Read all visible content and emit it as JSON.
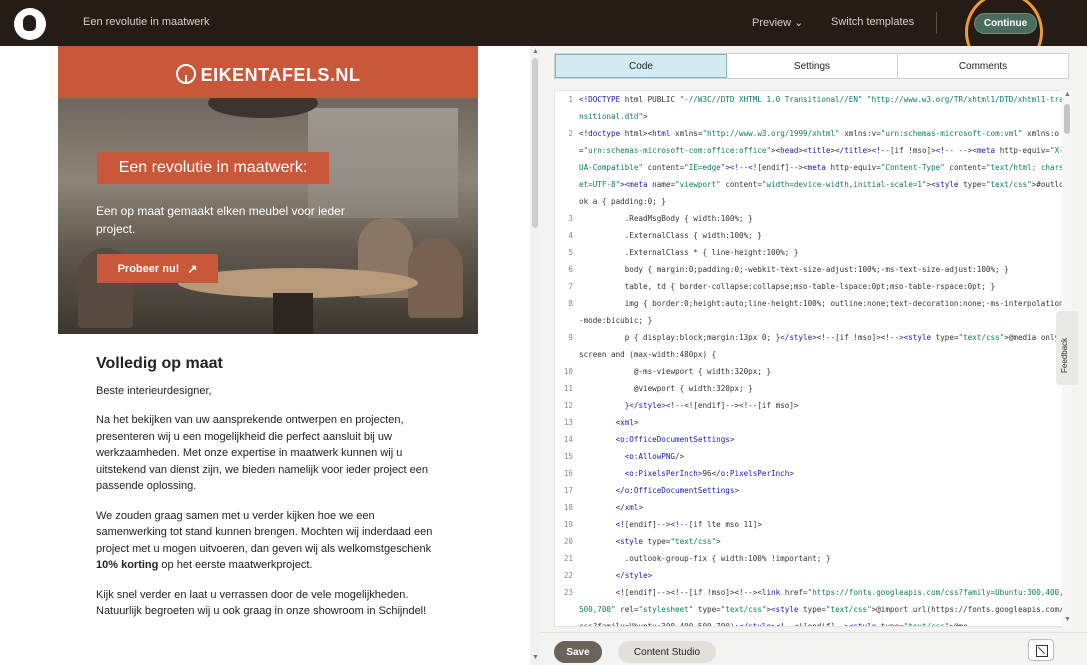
{
  "topbar": {
    "title": "Een revolutie in maatwerk",
    "preview_label": "Preview ⌄",
    "switch_label": "Switch templates",
    "continue_label": "Continue"
  },
  "email": {
    "brand": "EIKENTAFELS.NL",
    "headline": "Een revolutie in maatwerk:",
    "subtext": "Een op maat gemaakt elken meubel voor ieder project.",
    "cta": "Probeer nu!",
    "cta_arrow": "↗",
    "heading": "Volledig op maat",
    "greeting": "Beste interieurdesigner,",
    "p1": "Na het bekijken van uw aansprekende ontwerpen en projecten, presenteren wij u een mogelijkheid die perfect aansluit bij uw werkzaamheden. Met onze expertise in maatwerk kunnen wij u uitstekend van dienst zijn, we bieden namelijk voor ieder project een passende oplossing.",
    "p2a": "We zouden graag samen met u verder kijken hoe we een samenwerking tot stand kunnen brengen. Mochten wij inderdaad een project met u mogen uitvoeren, dan geven wij als welkomstgeschenk ",
    "p2b": "10% korting",
    "p2c": " op het eerste maatwerkproject.",
    "p3": "Kijk snel verder en laat u verrassen door de vele mogelijkheden. Natuurlijk begroeten wij u ook graag in onze showroom in Schijndel!"
  },
  "editor": {
    "tabs": [
      "Code",
      "Settings",
      "Comments"
    ],
    "active_tab": "Code",
    "feedback_label": "Feedback",
    "save_label": "Save",
    "studio_label": "Content Studio",
    "lines": [
      {
        "n": "1",
        "t": "<!DOCTYPE html PUBLIC \"-//W3C//DTD XHTML 1.0 Transitional//EN\" \"http://www.w3.org/TR/xhtml1/DTD/xhtml1-transitional.dtd\">"
      },
      {
        "n": "2",
        "t": "<!doctype html><html xmlns=\"http://www.w3.org/1999/xhtml\" xmlns:v=\"urn:schemas-microsoft-com:vml\" xmlns:o=\"urn:schemas-microsoft-com:office:office\"><head><title></title><!--[if !mso]><!-- --><meta http-equiv=\"X-UA-Compatible\" content=\"IE=edge\"><!--<![endif]--><meta http-equiv=\"Content-Type\" content=\"text/html; charset=UTF-8\"><meta name=\"viewport\" content=\"width=device-width,initial-scale=1\"><style type=\"text/css\">#outlook a { padding:0; }"
      },
      {
        "n": "3",
        "t": "          .ReadMsgBody { width:100%; }"
      },
      {
        "n": "4",
        "t": "          .ExternalClass { width:100%; }"
      },
      {
        "n": "5",
        "t": "          .ExternalClass * { line-height:100%; }"
      },
      {
        "n": "6",
        "t": "          body { margin:0;padding:0;-webkit-text-size-adjust:100%;-ms-text-size-adjust:100%; }"
      },
      {
        "n": "7",
        "t": "          table, td { border-collapse:collapse;mso-table-lspace:0pt;mso-table-rspace:0pt; }"
      },
      {
        "n": "8",
        "t": "          img { border:0;height:auto;line-height:100%; outline:none;text-decoration:none;-ms-interpolation-mode:bicubic; }"
      },
      {
        "n": "9",
        "t": "          p { display:block;margin:13px 0; }</style><!--[if !mso]><!--><style type=\"text/css\">@media only screen and (max-width:480px) {"
      },
      {
        "n": "10",
        "t": "            @-ms-viewport { width:320px; }"
      },
      {
        "n": "11",
        "t": "            @viewport { width:320px; }"
      },
      {
        "n": "12",
        "t": "          }</style><!--<![endif]--><!--[if mso]>"
      },
      {
        "n": "13",
        "t": "        <xml>"
      },
      {
        "n": "14",
        "t": "        <o:OfficeDocumentSettings>"
      },
      {
        "n": "15",
        "t": "          <o:AllowPNG/>"
      },
      {
        "n": "16",
        "t": "          <o:PixelsPerInch>96</o:PixelsPerInch>"
      },
      {
        "n": "17",
        "t": "        </o:OfficeDocumentSettings>"
      },
      {
        "n": "18",
        "t": "        </xml>"
      },
      {
        "n": "19",
        "t": "        <![endif]--><!--[if lte mso 11]>"
      },
      {
        "n": "20",
        "t": "        <style type=\"text/css\">"
      },
      {
        "n": "21",
        "t": "          .outlook-group-fix { width:100% !important; }"
      },
      {
        "n": "22",
        "t": "        </style>"
      },
      {
        "n": "23",
        "t": "        <![endif]--><!--[if !mso]><!--><link href=\"https://fonts.googleapis.com/css?family=Ubuntu:300,400,500,700\" rel=\"stylesheet\" type=\"text/css\"><style type=\"text/css\">@import url(https://fonts.googleapis.com/css?family=Ubuntu:300,400,500,700);</style><!--<![endif]--><style type=\"text/css\">@me"
      }
    ]
  }
}
